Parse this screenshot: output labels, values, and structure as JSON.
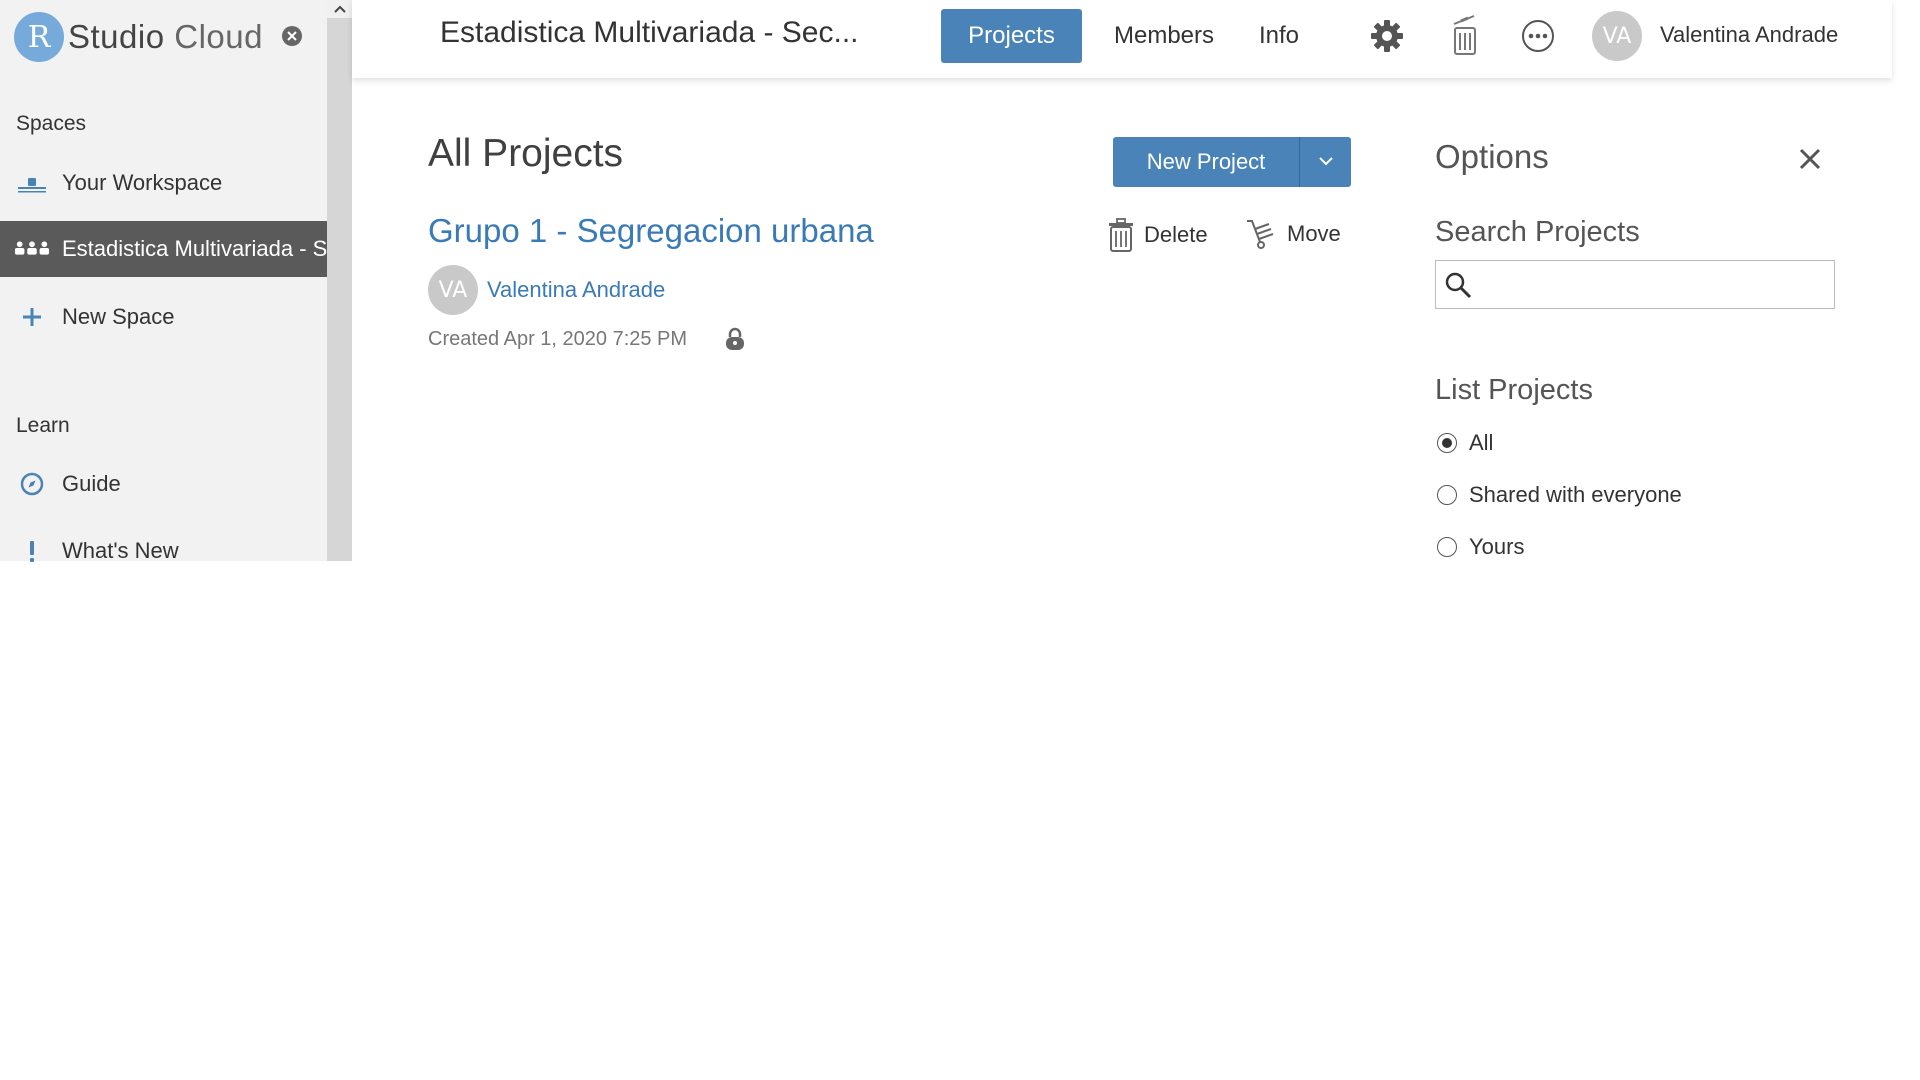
{
  "app": {
    "logo_letter": "R",
    "logo_name": "Studio",
    "logo_suffix": "Cloud"
  },
  "sidebar": {
    "spaces_heading": "Spaces",
    "items": [
      {
        "label": "Your Workspace",
        "icon": "workspace-icon"
      },
      {
        "label": "Estadistica Multivariada - Sec...",
        "icon": "group-icon",
        "active": true
      },
      {
        "label": "New Space",
        "icon": "plus-icon"
      }
    ],
    "learn_heading": "Learn",
    "learn_items": [
      {
        "label": "Guide",
        "icon": "compass-icon"
      },
      {
        "label": "What's New",
        "icon": "exclamation-icon"
      }
    ]
  },
  "header": {
    "space_title": "Estadistica Multivariada - Sec...",
    "nav": [
      {
        "label": "Projects",
        "active": true
      },
      {
        "label": "Members"
      },
      {
        "label": "Info"
      }
    ],
    "icons": [
      "gear-icon",
      "trash-icon",
      "more-icon"
    ],
    "user_initials": "VA",
    "user_name": "Valentina Andrade"
  },
  "main": {
    "title": "All Projects",
    "new_project_label": "New Project",
    "project": {
      "title": "Grupo 1 - Segregacion urbana",
      "owner_initials": "VA",
      "owner_name": "Valentina Andrade",
      "created": "Created Apr 1, 2020 7:25 PM"
    },
    "actions": {
      "delete_label": "Delete",
      "move_label": "Move"
    }
  },
  "options": {
    "title": "Options",
    "search_heading": "Search Projects",
    "search_value": "",
    "list_heading": "List Projects",
    "list_options": [
      {
        "label": "All",
        "selected": true
      },
      {
        "label": "Shared with everyone",
        "selected": false
      },
      {
        "label": "Yours",
        "selected": false
      }
    ]
  },
  "colors": {
    "accent": "#4a83b8",
    "link": "#3a7ab8",
    "sidebar_bg": "#f2f2f2",
    "active_item_bg": "#5a5a5a"
  }
}
